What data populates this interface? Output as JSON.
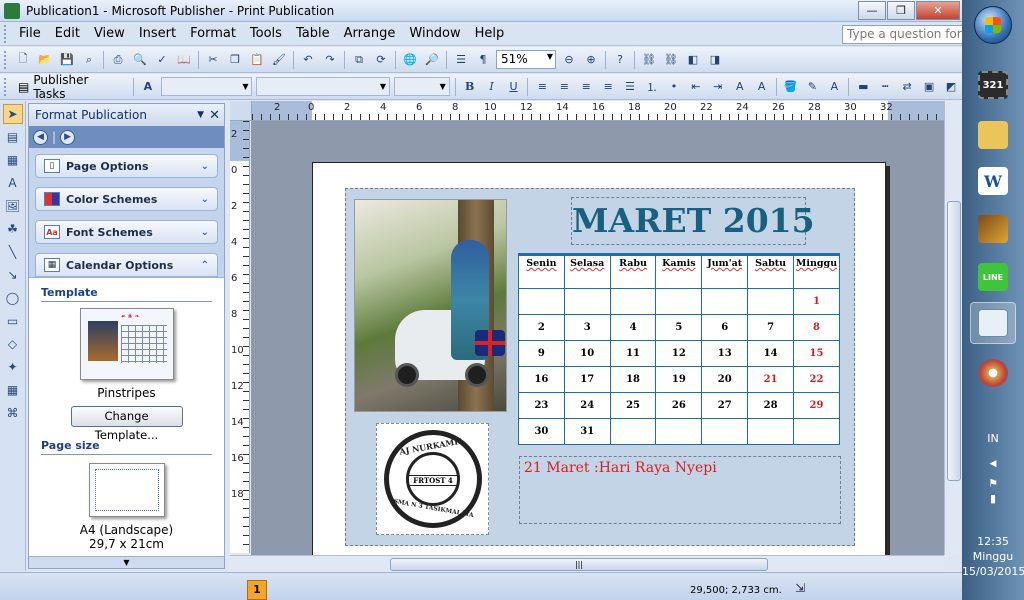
{
  "window": {
    "title": "Publication1 - Microsoft Publisher - Print Publication"
  },
  "menu": [
    "File",
    "Edit",
    "View",
    "Insert",
    "Format",
    "Tools",
    "Table",
    "Arrange",
    "Window",
    "Help"
  ],
  "help": {
    "placeholder": "Type a question for help"
  },
  "toolbar": {
    "zoom": "51%",
    "publisher_tasks": "Publisher Tasks"
  },
  "taskpane": {
    "title": "Format Publication",
    "sections": [
      "Page Options",
      "Color Schemes",
      "Font Schemes",
      "Calendar Options"
    ],
    "template_label": "Template",
    "template_name": "Pinstripes",
    "change_template": "Change Template...",
    "page_size_label": "Page size",
    "page_size_name": "A4 (Landscape)",
    "page_size_dims": "29,7 x 21cm"
  },
  "ruler": {
    "h_labels": [
      "2",
      "0",
      "2",
      "4",
      "6",
      "8",
      "10",
      "12",
      "14",
      "16",
      "18",
      "20",
      "22",
      "24",
      "26",
      "28",
      "30",
      "32"
    ],
    "v_labels": [
      "2",
      "0",
      "2",
      "4",
      "6",
      "8",
      "10",
      "12",
      "14",
      "16",
      "18"
    ]
  },
  "calendar": {
    "title": "MARET 2015",
    "days": [
      "Senin",
      "Selasa",
      "Rabu",
      "Kamis",
      "Jum'at",
      "Sabtu",
      "Minggu"
    ],
    "weeks": [
      [
        "",
        "",
        "",
        "",
        "",
        "",
        "1"
      ],
      [
        "2",
        "3",
        "4",
        "5",
        "6",
        "7",
        "8"
      ],
      [
        "9",
        "10",
        "11",
        "12",
        "13",
        "14",
        "15"
      ],
      [
        "16",
        "17",
        "18",
        "19",
        "20",
        "21",
        "22"
      ],
      [
        "23",
        "24",
        "25",
        "26",
        "27",
        "28",
        "29"
      ],
      [
        "30",
        "31",
        "",
        "",
        "",
        "",
        ""
      ]
    ],
    "holidays": [
      "21"
    ],
    "note": "21 Maret :Hari Raya Nyepi",
    "stamp_top": "AJ NURKAMIL",
    "stamp_center": "FRTOST 4",
    "stamp_bottom": "SMA N 3 TASIKMALAYA"
  },
  "status": {
    "page": "1",
    "coords": "29,500; 2,733 cm."
  },
  "taskbar": {
    "lang": "IN",
    "time": "12:35",
    "day": "Minggu",
    "date": "15/03/2015",
    "items": [
      "321",
      "folder",
      "W",
      "film",
      "LINE",
      "pub",
      "paint"
    ]
  },
  "colors": {
    "calendar_title": "#17607f",
    "holiday": "#d02020",
    "table_border": "#1f6fa3"
  }
}
